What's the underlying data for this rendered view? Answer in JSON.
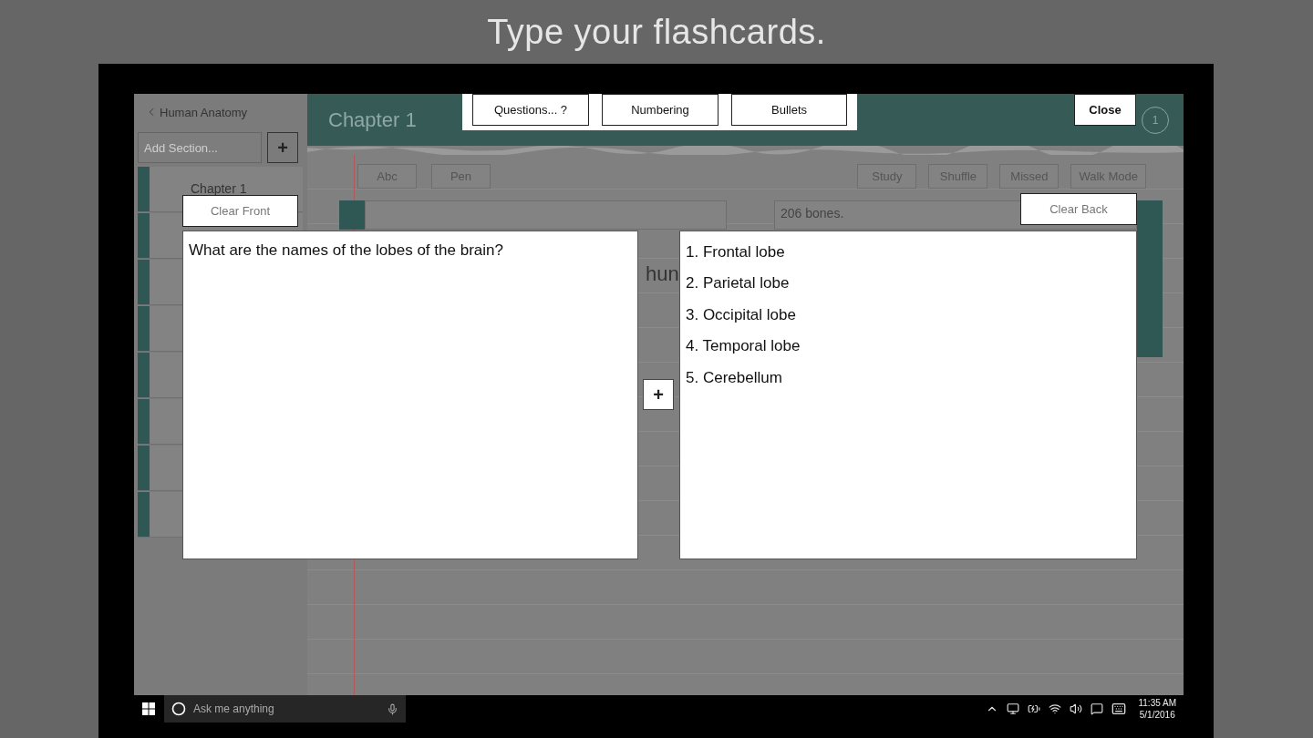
{
  "caption": "Type your flashcards.",
  "sidebar": {
    "back_link": "Human Anatomy",
    "add_section": {
      "placeholder": "Add Section..."
    },
    "add_button": "+",
    "sections": [
      {
        "kind": "titled",
        "title": "Chapter 1"
      },
      {
        "kind": "covered"
      },
      {
        "kind": "covered"
      },
      {
        "kind": "covered"
      },
      {
        "kind": "covered"
      },
      {
        "kind": "covered"
      },
      {
        "kind": "covered"
      },
      {
        "kind": "covered"
      }
    ]
  },
  "header": {
    "title": "Chapter 1"
  },
  "toolbar": {
    "left": [
      "Abc",
      "Pen"
    ],
    "right": [
      "Study",
      "Shuffle",
      "Missed",
      "Walk Mode"
    ]
  },
  "card": {
    "front_peek": "hun",
    "back_preview": "206 bones."
  },
  "editor": {
    "format_buttons": [
      "Questions... ?",
      "Numbering",
      "Bullets"
    ],
    "close": "Close",
    "page_badge": "1",
    "clear_front": "Clear Front",
    "clear_back": "Clear Back",
    "front_text": "What are the names of the lobes of the brain?",
    "back_lines": [
      "1. Frontal lobe",
      "2. Parietal lobe",
      "3. Occipital lobe",
      "4. Temporal lobe",
      "5. Cerebellum"
    ],
    "add_button": "+"
  },
  "taskbar": {
    "search_placeholder": "Ask me anything",
    "time": "11:35 AM",
    "date": "5/1/2016"
  }
}
